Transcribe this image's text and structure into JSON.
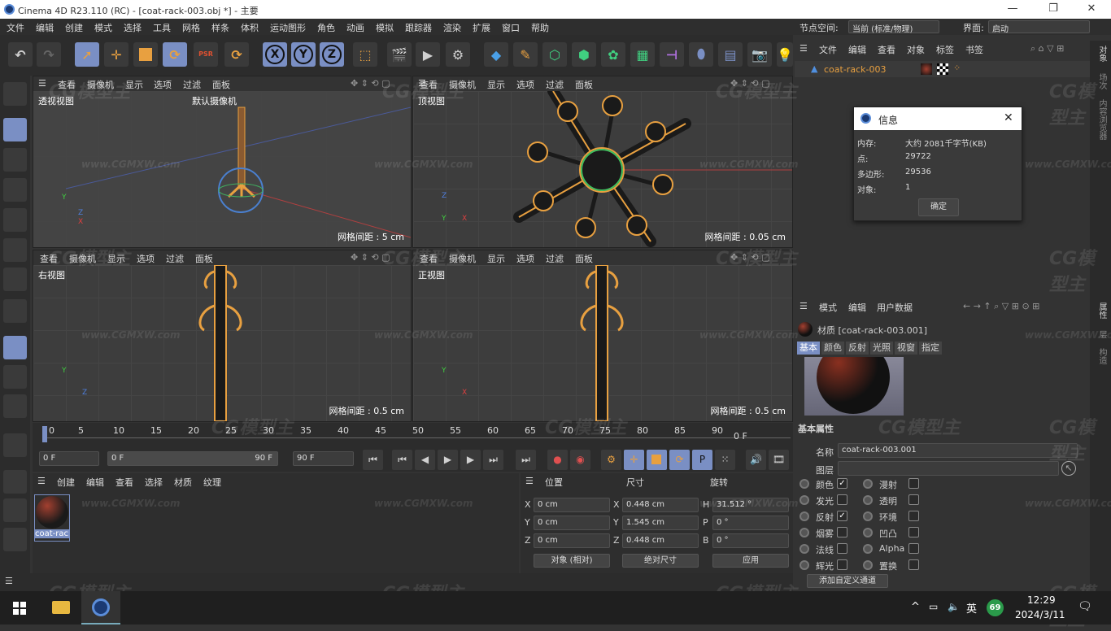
{
  "window": {
    "title": "Cinema 4D R23.110 (RC) - [coat-rack-003.obj *] - 主要",
    "minimize": "—",
    "maximize": "❐",
    "close": "✕"
  },
  "menu": {
    "items": [
      "文件",
      "编辑",
      "创建",
      "模式",
      "选择",
      "工具",
      "网格",
      "样条",
      "体积",
      "运动图形",
      "角色",
      "动画",
      "模拟",
      "跟踪器",
      "渲染",
      "扩展",
      "窗口",
      "帮助"
    ],
    "node_space_label": "节点空间:",
    "node_space_value": "当前 (标准/物理)",
    "layout_label": "界面:",
    "layout_value": "启动"
  },
  "toolbar": {
    "undo": "↶",
    "redo": "↷",
    "x": "X",
    "y": "Y",
    "z": "Z",
    "psr": "PSR"
  },
  "viewports": {
    "menu": [
      "查看",
      "摄像机",
      "显示",
      "选项",
      "过滤",
      "面板"
    ],
    "perspective": {
      "label": "透视视图",
      "camera": "默认摄像机",
      "grid": "网格间距 : 5 cm"
    },
    "top": {
      "label": "顶视图",
      "grid": "网格间距 : 0.05 cm"
    },
    "right": {
      "label": "右视图",
      "grid": "网格间距 : 0.5 cm"
    },
    "front": {
      "label": "正视图",
      "grid": "网格间距 : 0.5 cm"
    },
    "axes": {
      "x": "X",
      "y": "Y",
      "z": "Z"
    }
  },
  "timeline": {
    "ticks": [
      "0",
      "5",
      "10",
      "15",
      "20",
      "25",
      "30",
      "35",
      "40",
      "45",
      "50",
      "55",
      "60",
      "65",
      "70",
      "75",
      "80",
      "85",
      "90"
    ],
    "frame_end": "0 F"
  },
  "playback": {
    "start": "0 F",
    "range_start": "0 F",
    "range_end": "90 F",
    "end": "90 F"
  },
  "material_manager": {
    "menu": [
      "创建",
      "编辑",
      "查看",
      "选择",
      "材质",
      "纹理"
    ],
    "material_name": "coat-rac"
  },
  "coordinates": {
    "headers": [
      "位置",
      "尺寸",
      "旋转"
    ],
    "rows": [
      {
        "axis": "X",
        "pos": "0 cm",
        "size_axis": "X",
        "size": "0.448 cm",
        "rot_axis": "H",
        "rot": "31.512 °"
      },
      {
        "axis": "Y",
        "pos": "0 cm",
        "size_axis": "Y",
        "size": "1.545 cm",
        "rot_axis": "P",
        "rot": "0 °"
      },
      {
        "axis": "Z",
        "pos": "0 cm",
        "size_axis": "Z",
        "size": "0.448 cm",
        "rot_axis": "B",
        "rot": "0 °"
      }
    ],
    "mode": "对象 (相对)",
    "size_mode": "绝对尺寸",
    "apply": "应用"
  },
  "object_manager": {
    "menu": [
      "文件",
      "编辑",
      "查看",
      "对象",
      "标签",
      "书签"
    ],
    "object_name": "coat-rack-003"
  },
  "info_dialog": {
    "title": "信息",
    "close": "✕",
    "rows": [
      {
        "label": "内存:",
        "value": "大约 2081千字节(KB)"
      },
      {
        "label": "点:",
        "value": "29722"
      },
      {
        "label": "多边形:",
        "value": "29536"
      },
      {
        "label": "对象:",
        "value": "1"
      }
    ],
    "ok": "确定"
  },
  "attributes": {
    "menu": [
      "模式",
      "编辑",
      "用户数据"
    ],
    "title": "材质 [coat-rack-003.001]",
    "tabs": [
      "基本",
      "颜色",
      "反射",
      "光照",
      "视窗",
      "指定"
    ],
    "section": "基本属性",
    "name_label": "名称",
    "name_value": "coat-rack-003.001",
    "layer_label": "图层",
    "channels_left": [
      {
        "label": "颜色",
        "checked": true
      },
      {
        "label": "发光",
        "checked": false
      },
      {
        "label": "反射",
        "checked": true
      },
      {
        "label": "烟雾",
        "checked": false
      },
      {
        "label": "法线",
        "checked": false
      },
      {
        "label": "辉光",
        "checked": false
      }
    ],
    "channels_right": [
      {
        "label": "漫射",
        "checked": false
      },
      {
        "label": "透明",
        "checked": false
      },
      {
        "label": "环境",
        "checked": false
      },
      {
        "label": "凹凸",
        "checked": false
      },
      {
        "label": "Alpha",
        "checked": false
      },
      {
        "label": "置换",
        "checked": false
      }
    ],
    "add_channel": "添加自定义通道"
  },
  "right_tabs": [
    "对象",
    "场次",
    "内容浏览器",
    "属性",
    "层",
    "构造"
  ],
  "watermark": "CG模型主",
  "watermark_url": "www.CGMXW.com",
  "taskbar": {
    "time": "12:29",
    "date": "2024/3/11",
    "ime": "英",
    "badge": "69",
    "chevron": "^"
  }
}
